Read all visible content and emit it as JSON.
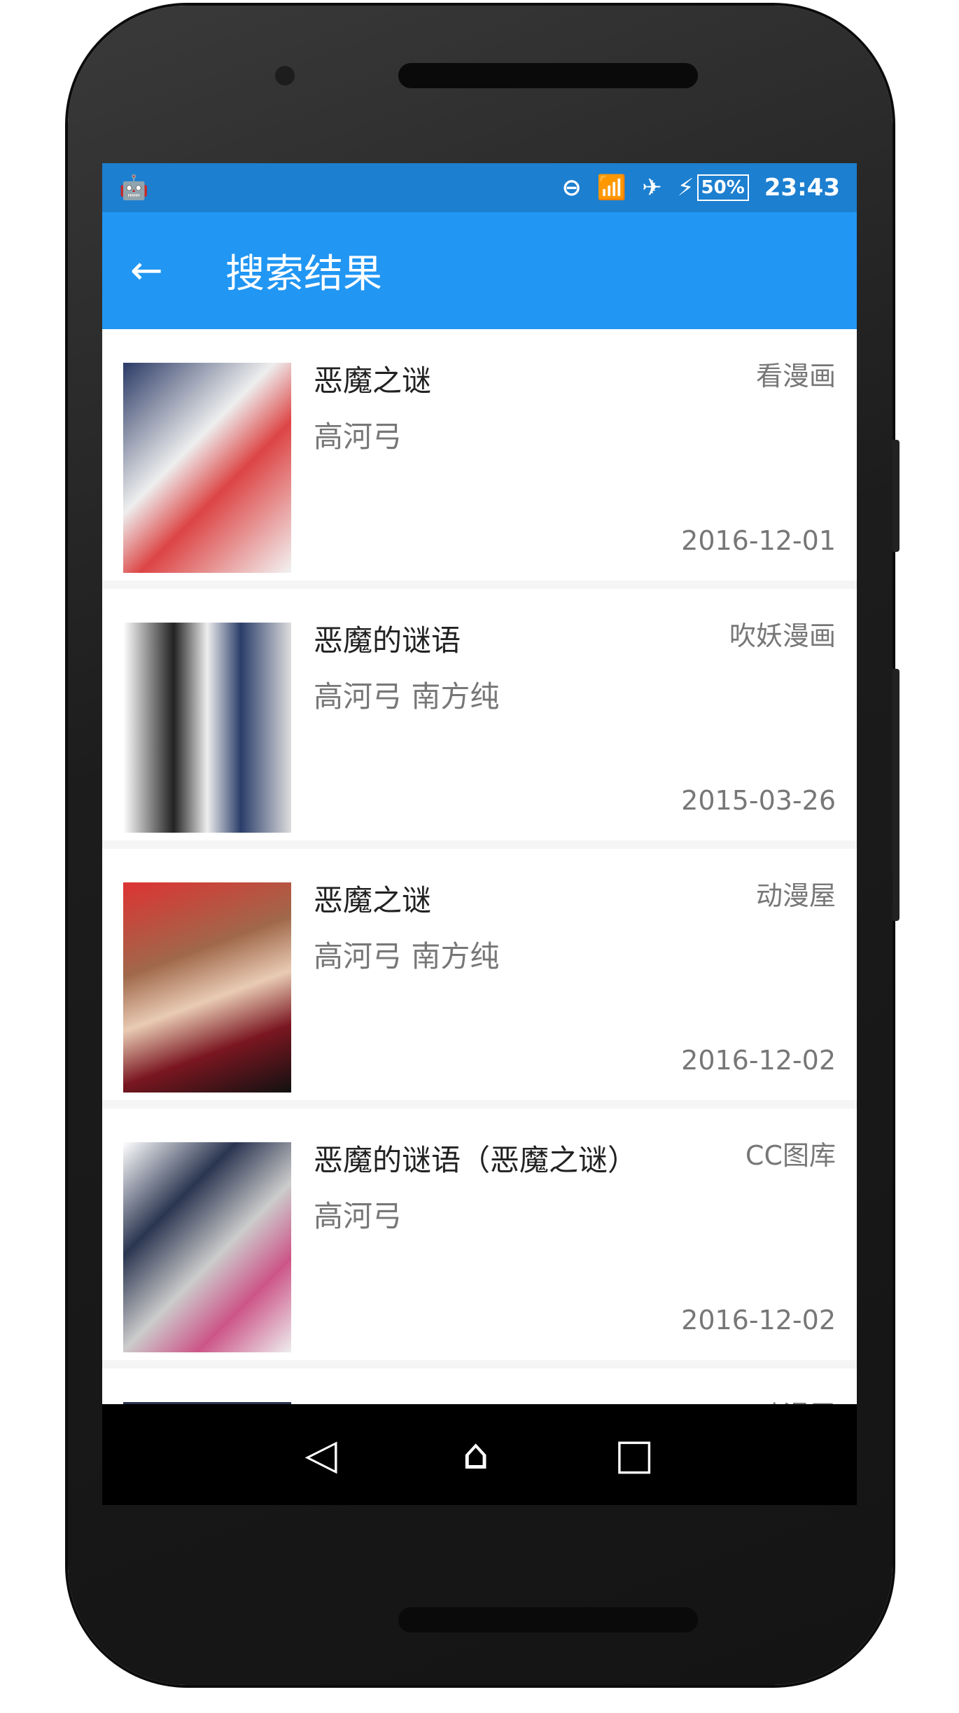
{
  "status_bar": {
    "battery": "50%",
    "time": "23:43"
  },
  "toolbar": {
    "title": "搜索结果"
  },
  "results": [
    {
      "title": "恶魔之谜",
      "author": "高河弓",
      "source": "看漫画",
      "date": "2016-12-01",
      "color": "#c9cfe0"
    },
    {
      "title": "恶魔的谜语",
      "author": "高河弓 南方纯",
      "source": "吹妖漫画",
      "date": "2015-03-26",
      "color": "#bdbdbd"
    },
    {
      "title": "恶魔之谜",
      "author": "高河弓  南方纯",
      "source": "动漫屋",
      "date": "2016-12-02",
      "color": "#b0705a"
    },
    {
      "title": "恶魔的谜语（恶魔之谜）",
      "author": "高河弓",
      "source": "CC图库",
      "date": "2016-12-02",
      "color": "#c8c8d0"
    },
    {
      "title": "女神的谜语",
      "author": "",
      "source": "动漫屋",
      "date": "",
      "color": "#2b3550"
    }
  ]
}
